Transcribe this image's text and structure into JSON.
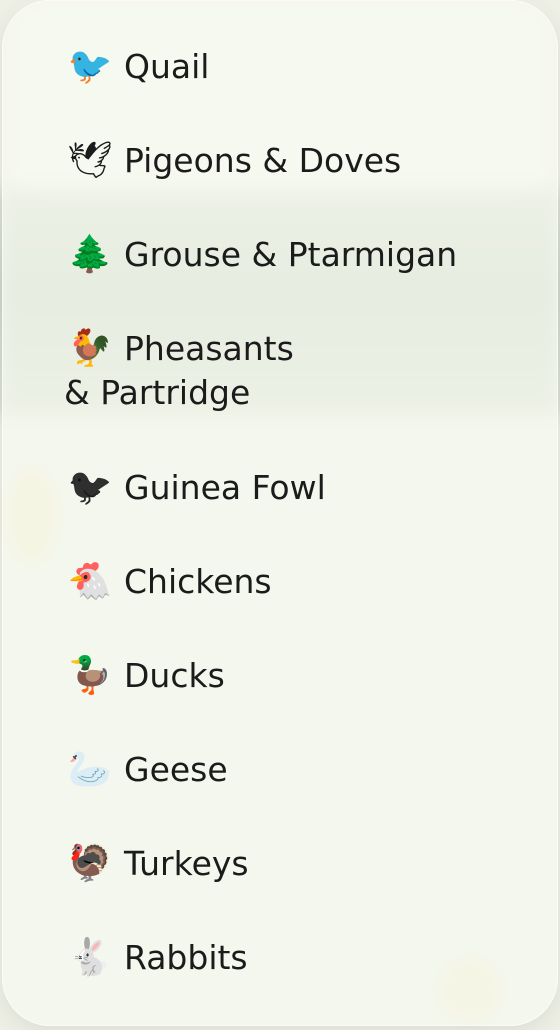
{
  "menu": {
    "items": [
      {
        "label": "Quail",
        "icon": "quail-icon",
        "glyph": "🐦"
      },
      {
        "label": "Pigeons & Doves",
        "icon": "dove-icon",
        "glyph": "🕊"
      },
      {
        "label": "Grouse & Ptarmigan",
        "icon": "evergreen-tree-icon",
        "glyph": "🌲"
      },
      {
        "label": "Pheasants",
        "label2": "& Partridge",
        "icon": "rooster-icon",
        "glyph": "🐓"
      },
      {
        "label": "Guinea Fowl",
        "icon": "black-bird-icon",
        "glyph": "🐦"
      },
      {
        "label": "Chickens",
        "icon": "chicken-icon",
        "glyph": "🐔"
      },
      {
        "label": "Ducks",
        "icon": "duck-icon",
        "glyph": "🦆"
      },
      {
        "label": "Geese",
        "icon": "goose-icon",
        "glyph": "🦢"
      },
      {
        "label": "Turkeys",
        "icon": "turkey-icon",
        "glyph": "🦃"
      },
      {
        "label": "Rabbits",
        "icon": "rabbit-icon",
        "glyph": "🐇"
      }
    ]
  }
}
